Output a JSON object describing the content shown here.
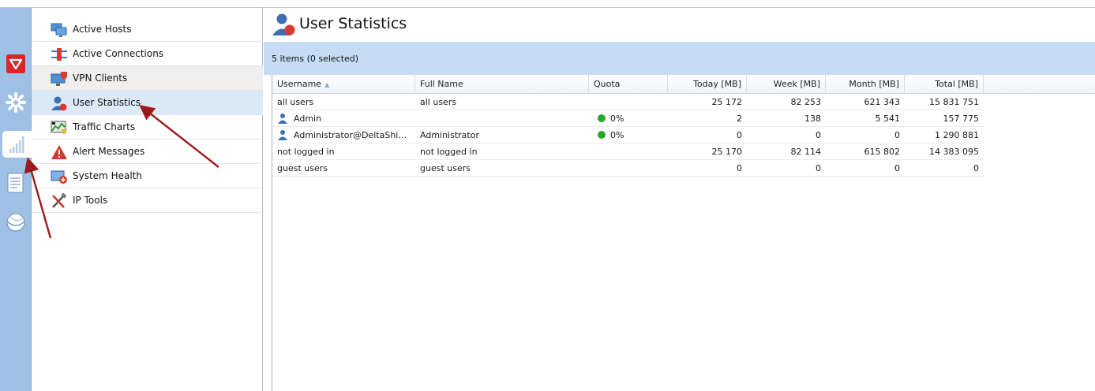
{
  "colors": {
    "rail_bg": "#9ec0e4",
    "status_bar_bg": "#c5dcf4",
    "selected_bg": "#dce9f7",
    "quota_ok": "#2aa52a",
    "annotation_arrow": "#9b1b1b"
  },
  "rail": {
    "items": [
      {
        "icon": "shield-icon"
      },
      {
        "icon": "gear-icon"
      },
      {
        "icon": "bar-chart-icon",
        "active": true
      },
      {
        "icon": "log-document-icon"
      },
      {
        "icon": "globe-icon"
      }
    ]
  },
  "nav": {
    "items": [
      {
        "label": "Active Hosts",
        "icon": "hosts-icon"
      },
      {
        "label": "Active Connections",
        "icon": "connections-icon"
      },
      {
        "label": "VPN Clients",
        "icon": "vpn-clients-icon"
      },
      {
        "label": "User Statistics",
        "icon": "user-statistics-icon"
      },
      {
        "label": "Traffic Charts",
        "icon": "traffic-charts-icon"
      },
      {
        "label": "Alert Messages",
        "icon": "alert-icon"
      },
      {
        "label": "System Health",
        "icon": "system-health-icon"
      },
      {
        "label": "IP Tools",
        "icon": "ip-tools-icon"
      }
    ]
  },
  "main": {
    "title": "User Statistics",
    "status": "5 items (0 selected)",
    "columns": [
      "Username",
      "Full Name",
      "Quota",
      "Today [MB]",
      "Week [MB]",
      "Month [MB]",
      "Total [MB]"
    ],
    "sort_indicator": "▲",
    "rows": [
      {
        "username": "all users",
        "fullname": "all users",
        "quota": "",
        "today": "25 172",
        "week": "82 253",
        "month": "621 343",
        "total": "15 831 751",
        "user_icon": false
      },
      {
        "username": "Admin",
        "fullname": "",
        "quota": "0%",
        "today": "2",
        "week": "138",
        "month": "5 541",
        "total": "157 775",
        "user_icon": true
      },
      {
        "username": "Administrator@DeltaShippin...",
        "fullname": "Administrator",
        "quota": "0%",
        "today": "0",
        "week": "0",
        "month": "0",
        "total": "1 290 881",
        "user_icon": true
      },
      {
        "username": "not logged in",
        "fullname": "not logged in",
        "quota": "",
        "today": "25 170",
        "week": "82 114",
        "month": "615 802",
        "total": "14 383 095",
        "user_icon": false
      },
      {
        "username": "guest users",
        "fullname": "guest users",
        "quota": "",
        "today": "0",
        "week": "0",
        "month": "0",
        "total": "0",
        "user_icon": false
      }
    ]
  }
}
